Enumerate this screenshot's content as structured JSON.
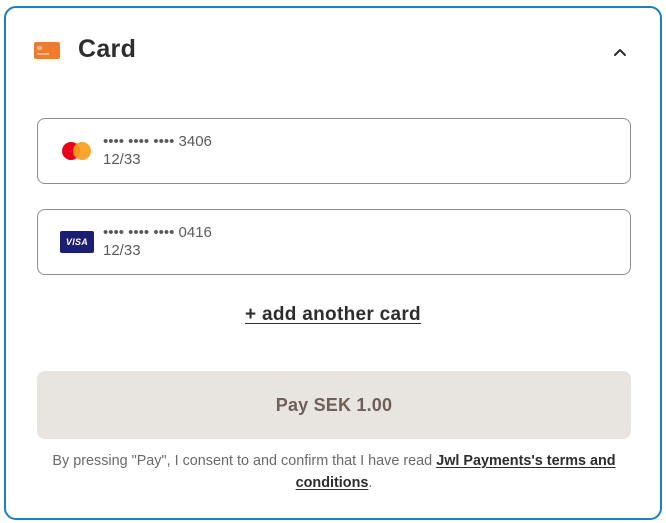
{
  "header": {
    "title": "Card",
    "icon": "credit-card-icon",
    "toggle_icon": "chevron-up-icon"
  },
  "saved_cards": [
    {
      "brand": "mastercard",
      "number": "•••• •••• •••• 3406",
      "expiry": "12/33"
    },
    {
      "brand": "visa",
      "brand_label": "VISA",
      "number": "•••• •••• •••• 0416",
      "expiry": "12/33"
    }
  ],
  "add_card_label": "+ add another card",
  "pay_button_label": "Pay SEK 1.00",
  "consent": {
    "text": "By pressing \"Pay\", I consent to and confirm that I have read ",
    "link_text": "Jwl Payments's terms and conditions",
    "suffix": "."
  },
  "colors": {
    "border_accent": "#1f7ec2",
    "card_icon": "#f07b2c",
    "mastercard_red": "#eb001b",
    "mastercard_orange": "#f79e1b",
    "visa_blue": "#1a1f71",
    "pay_button_bg": "#e8e5e1"
  }
}
